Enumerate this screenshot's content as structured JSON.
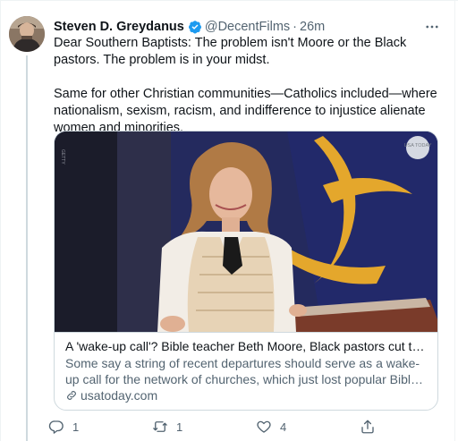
{
  "tweet": {
    "author_name": "Steven D. Greydanus",
    "handle": "@DecentFilms",
    "separator": "·",
    "time": "26m",
    "paragraphs": [
      "Dear Southern Baptists: The problem isn't Moore or the Black pastors. The problem is in your midst.",
      "Same for other Christian communities—Catholics included—where nationalism, sexism, racism, and indifference to injustice alienate women and minorities."
    ]
  },
  "card": {
    "title": "A 'wake-up call'? Bible teacher Beth Moore, Black pastors cut ties with …",
    "description": "Some say a string of recent departures should serve as a wake-up call for the network of churches, which just lost popular Bible teacher Beth …",
    "domain": "usatoday.com",
    "image_credit": "GETTY",
    "image_badge": "USA TODAY"
  },
  "actions": {
    "reply_count": "1",
    "retweet_count": "1",
    "like_count": "4"
  },
  "icons": {
    "verified": "verified-badge-icon",
    "more": "more-dots-icon",
    "link": "link-icon",
    "reply": "reply-icon",
    "retweet": "retweet-icon",
    "like": "heart-icon",
    "share": "share-icon"
  },
  "colors": {
    "accent": "#1d9bf0",
    "text": "#0f1419",
    "secondary": "#536471",
    "border": "#cfd9de"
  }
}
